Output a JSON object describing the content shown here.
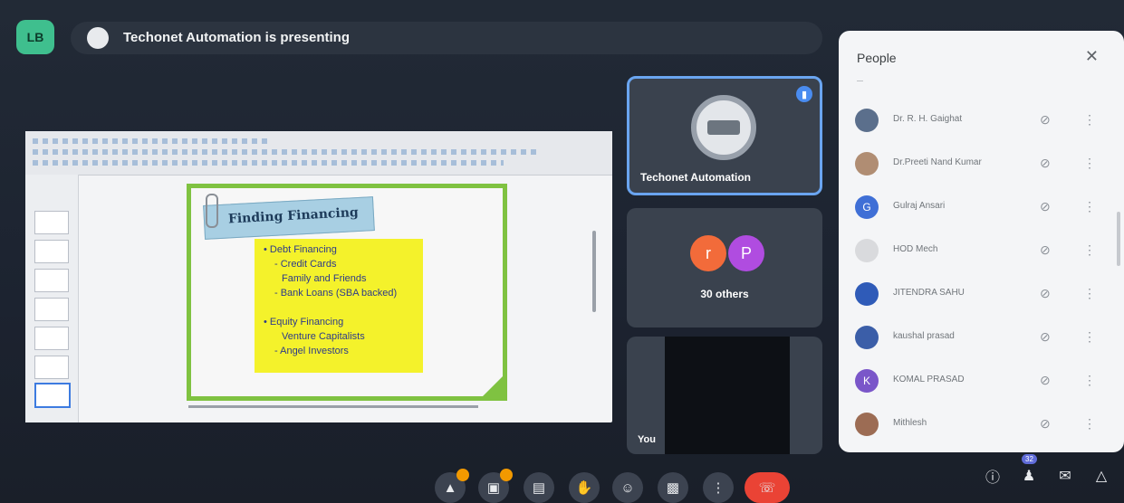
{
  "header": {
    "self_avatar": "LB",
    "presenting_text": "Techonet Automation is presenting"
  },
  "slide": {
    "title": "Finding Financing",
    "bullets": [
      "• Debt Financing",
      "- Credit Cards",
      "Family and Friends",
      "- Bank Loans (SBA backed)",
      "• Equity Financing",
      "Venture Capitalists",
      "- Angel Investors"
    ]
  },
  "tiles": {
    "presenter_name": "Techonet Automation",
    "others_label": "30 others",
    "others_avatars": [
      {
        "letter": "r",
        "color": "#f26b3a"
      },
      {
        "letter": "P",
        "color": "#b04ce0"
      }
    ],
    "self_label": "You"
  },
  "people": {
    "title": "People",
    "close_icon": "close-icon",
    "members": [
      {
        "name": "Dr. R. H. Gaighat",
        "avatar": "",
        "color": "#5b6f8c"
      },
      {
        "name": "Dr.Preeti Nand Kumar",
        "avatar": "",
        "color": "#b08d73"
      },
      {
        "name": "Gulraj Ansari",
        "avatar": "G",
        "color": "#3f6fd6"
      },
      {
        "name": "HOD Mech",
        "avatar": "",
        "color": "#d9dadd"
      },
      {
        "name": "JITENDRA SAHU",
        "avatar": "",
        "color": "#2f5bb8"
      },
      {
        "name": "kaushal prasad",
        "avatar": "",
        "color": "#3b5ea8"
      },
      {
        "name": "KOMAL PRASAD",
        "avatar": "K",
        "color": "#7a56c9"
      },
      {
        "name": "Mithlesh",
        "avatar": "",
        "color": "#9c6c54"
      }
    ]
  },
  "controls": {
    "participants_count": "32"
  }
}
